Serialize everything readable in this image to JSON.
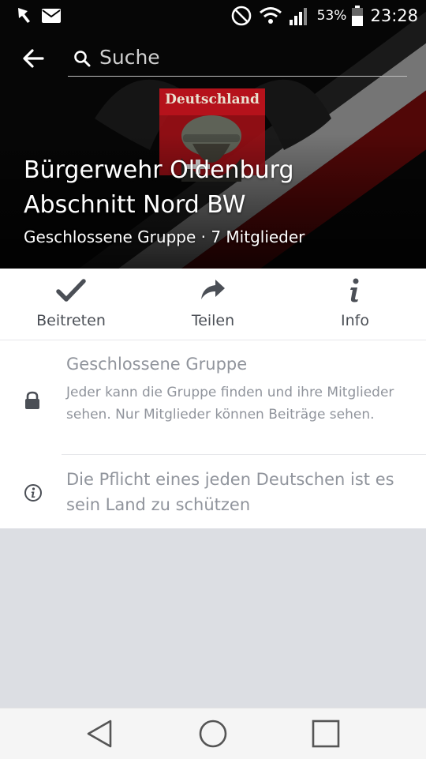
{
  "status_bar": {
    "battery_percent": "53%",
    "time": "23:28",
    "icons": [
      "notification-flag-icon",
      "mail-icon",
      "do-not-disturb-icon",
      "wifi-icon",
      "signal-icon",
      "battery-icon"
    ]
  },
  "search": {
    "placeholder": "Suche"
  },
  "cover": {
    "banner_text": "Deutschland"
  },
  "group": {
    "title_line1": "Bürgerwehr Oldenburg",
    "title_line2": "Abschnitt Nord BW",
    "meta": "Geschlossene Gruppe · 7 Mitglieder"
  },
  "actions": [
    {
      "label": "Beitreten",
      "icon": "checkmark-icon"
    },
    {
      "label": "Teilen",
      "icon": "share-arrow-icon"
    },
    {
      "label": "Info",
      "icon": "info-icon"
    }
  ],
  "privacy": {
    "title": "Geschlossene Gruppe",
    "description": "Jeder kann die Gruppe finden und ihre Mitglieder sehen. Nur Mitglieder können Beiträge sehen.",
    "icon": "lock-icon"
  },
  "about": {
    "text": "Die Pflicht eines jeden Deutschen ist es sein Land zu schützen",
    "icon": "info-circle-icon"
  },
  "navbar": {
    "icons": [
      "back-triangle-icon",
      "home-circle-icon",
      "recents-square-icon"
    ]
  },
  "colors": {
    "icon_gray": "#4b4f56",
    "text_muted": "#90949c",
    "page_bg": "#dcdee3",
    "banner_red": "#b5121b"
  }
}
